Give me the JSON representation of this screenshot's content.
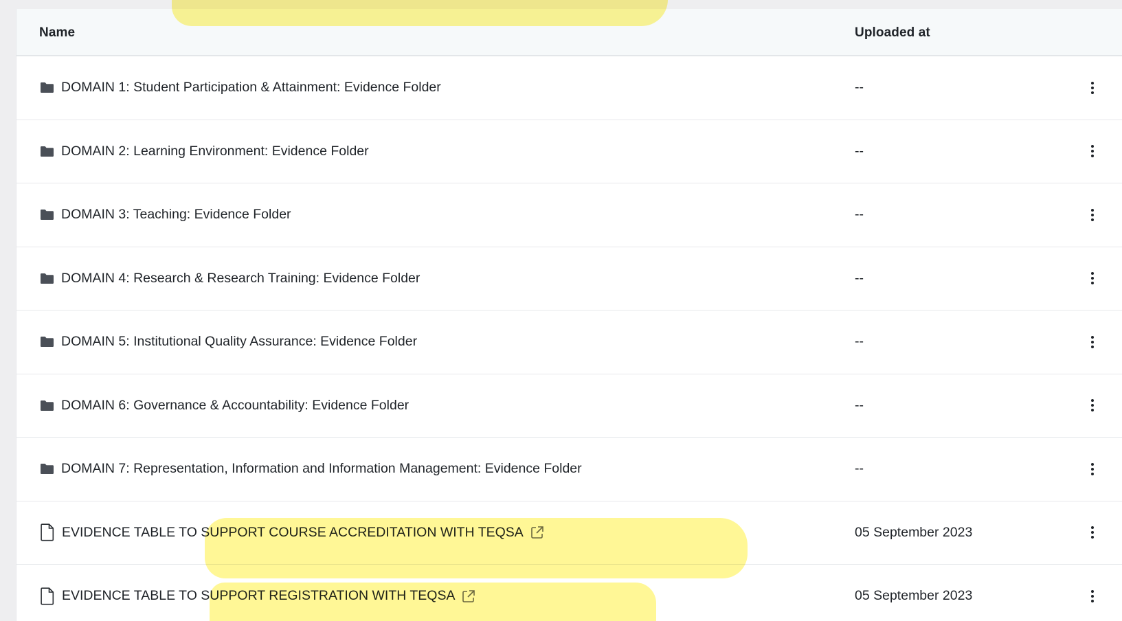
{
  "table": {
    "headers": {
      "name": "Name",
      "uploaded_at": "Uploaded at"
    },
    "rows": [
      {
        "type": "folder",
        "icon": "folder-icon",
        "name": "DOMAIN 1: Student Participation & Attainment: Evidence Folder",
        "uploaded_at": "--",
        "external": false
      },
      {
        "type": "folder",
        "icon": "folder-icon",
        "name": "DOMAIN 2: Learning Environment: Evidence Folder",
        "uploaded_at": "--",
        "external": false
      },
      {
        "type": "folder",
        "icon": "folder-icon",
        "name": "DOMAIN 3: Teaching: Evidence Folder",
        "uploaded_at": "--",
        "external": false
      },
      {
        "type": "folder",
        "icon": "folder-icon",
        "name": "DOMAIN 4: Research & Research Training: Evidence Folder",
        "uploaded_at": "--",
        "external": false
      },
      {
        "type": "folder",
        "icon": "folder-icon",
        "name": "DOMAIN 5: Institutional Quality Assurance: Evidence Folder",
        "uploaded_at": "--",
        "external": false
      },
      {
        "type": "folder",
        "icon": "folder-icon",
        "name": "DOMAIN 6: Governance & Accountability: Evidence Folder",
        "uploaded_at": "--",
        "external": false
      },
      {
        "type": "folder",
        "icon": "folder-icon",
        "name": "DOMAIN 7: Representation, Information and Information Management: Evidence Folder",
        "uploaded_at": "--",
        "external": false
      },
      {
        "type": "file",
        "icon": "file-icon",
        "name": "EVIDENCE TABLE TO SUPPORT COURSE ACCREDITATION WITH TEQSA",
        "uploaded_at": "05 September 2023",
        "external": true
      },
      {
        "type": "file",
        "icon": "file-icon",
        "name": "EVIDENCE TABLE TO SUPPORT REGISTRATION WITH TEQSA",
        "uploaded_at": "05 September 2023",
        "external": true
      }
    ]
  },
  "colors": {
    "highlight": "#fff250",
    "header_bg": "#f6f9fa",
    "text": "#1f2328",
    "page_bg": "#eeeef0"
  }
}
